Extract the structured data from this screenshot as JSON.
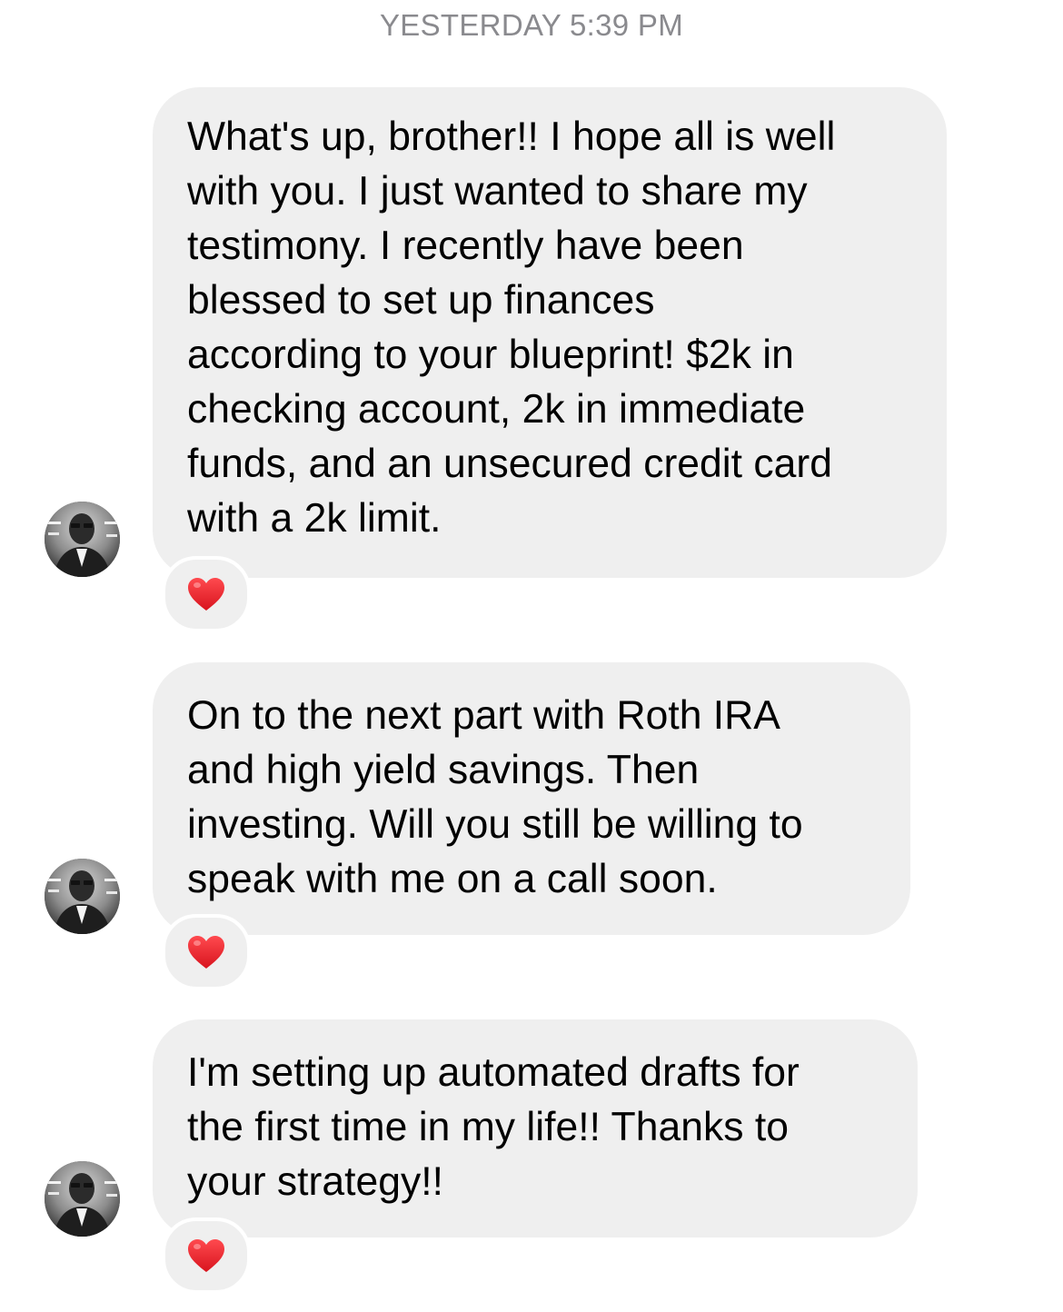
{
  "conversation": {
    "timestamp": "YESTERDAY 5:39 PM",
    "messages": [
      {
        "text": "What's up, brother!! I hope all is well\nwith you. I just wanted to share my\ntestimony. I recently have been\nblessed to set up finances\naccording to your blueprint! $2k in\nchecking account, 2k in immediate\nfunds, and an unsecured credit card\nwith a 2k limit.",
        "reaction": "heart-icon"
      },
      {
        "text": "On to the next part with Roth IRA\nand high yield savings.  Then\ninvesting. Will you still be willing to\nspeak with me on a call soon.",
        "reaction": "heart-icon"
      },
      {
        "text": "I'm setting up automated drafts for\nthe first time in my life!! Thanks to\nyour strategy!!",
        "reaction": "heart-icon"
      }
    ]
  },
  "colors": {
    "bubble_background": "#efefef",
    "timestamp_text": "#8a8a8e",
    "heart": "#e8232e"
  }
}
